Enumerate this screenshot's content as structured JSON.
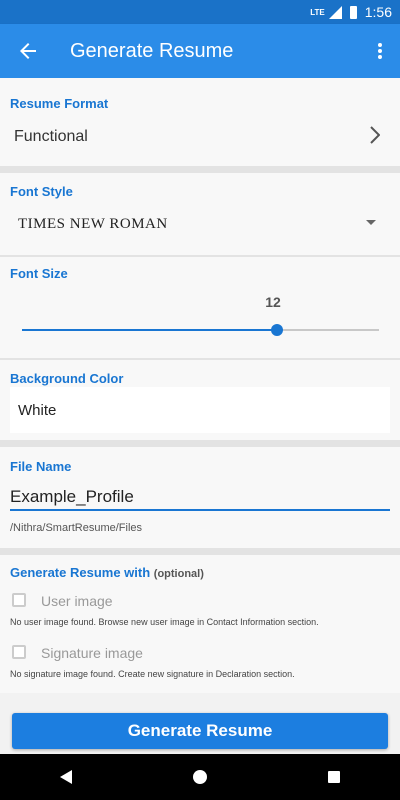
{
  "status": {
    "network": "LTE",
    "time": "1:56"
  },
  "app_bar": {
    "title": "Generate Resume",
    "back_icon": "arrow-back-icon",
    "more_icon": "more-vert-icon"
  },
  "resume_format": {
    "label": "Resume Format",
    "value": "Functional"
  },
  "font_style": {
    "label": "Font Style",
    "value": "TIMES NEW ROMAN"
  },
  "font_size": {
    "label": "Font Size",
    "value": "12",
    "slider_fraction": 0.715
  },
  "background_color": {
    "label": "Background Color",
    "value": "White"
  },
  "file_name": {
    "label": "File Name",
    "value": "Example_Profile",
    "path": "/Nithra/SmartResume/Files"
  },
  "generate_with": {
    "label": "Generate Resume with",
    "optional": "(optional)",
    "user_image": {
      "label": "User image",
      "note": "No user image found. Browse new user image in Contact Information section."
    },
    "signature_image": {
      "label": "Signature image",
      "note": "No signature image found. Create new signature in Declaration section."
    }
  },
  "generate_button": "Generate Resume",
  "colors": {
    "accent": "#1976d2",
    "app_bar": "#2b8ce8",
    "status_bar": "#1a72c8"
  }
}
